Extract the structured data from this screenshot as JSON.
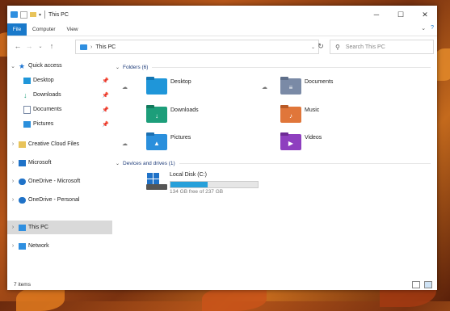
{
  "window": {
    "title": "This PC"
  },
  "ribbon": {
    "tabs": [
      "File",
      "Computer",
      "View"
    ]
  },
  "address": {
    "path": "This PC",
    "search_placeholder": "Search This PC"
  },
  "nav": {
    "items": [
      {
        "label": "Quick access",
        "icon": "star-icon"
      },
      {
        "label": "Desktop",
        "icon": "desktop-folder-icon"
      },
      {
        "label": "Downloads",
        "icon": "downloads-icon"
      },
      {
        "label": "Documents",
        "icon": "documents-icon"
      },
      {
        "label": "Pictures",
        "icon": "pictures-icon"
      },
      {
        "label": "Creative Cloud Files",
        "icon": "creative-cloud-icon"
      },
      {
        "label": "Microsoft",
        "icon": "folder-icon"
      },
      {
        "label": "OneDrive - Microsoft",
        "icon": "onedrive-icon"
      },
      {
        "label": "OneDrive - Personal",
        "icon": "onedrive-icon"
      },
      {
        "label": "This PC",
        "icon": "this-pc-icon"
      },
      {
        "label": "Network",
        "icon": "network-icon"
      }
    ]
  },
  "folders": {
    "header": "Folders (6)",
    "items": [
      {
        "label": "Desktop",
        "color": "#1f96d9",
        "icon": "desktop-folder-icon"
      },
      {
        "label": "Documents",
        "color": "#7a8aa6",
        "icon": "documents-folder-icon"
      },
      {
        "label": "Downloads",
        "color": "#1d9e7a",
        "icon": "downloads-folder-icon"
      },
      {
        "label": "Music",
        "color": "#e0763a",
        "icon": "music-folder-icon"
      },
      {
        "label": "Pictures",
        "color": "#2a8fdc",
        "icon": "pictures-folder-icon"
      },
      {
        "label": "Videos",
        "color": "#8e3fbf",
        "icon": "videos-folder-icon"
      }
    ]
  },
  "drives": {
    "header": "Devices and drives (1)",
    "items": [
      {
        "label": "Local Disk (C:)",
        "free_text": "134 GB free of 237 GB",
        "used_fraction": 0.43
      }
    ]
  },
  "status": {
    "items": "7 items"
  }
}
